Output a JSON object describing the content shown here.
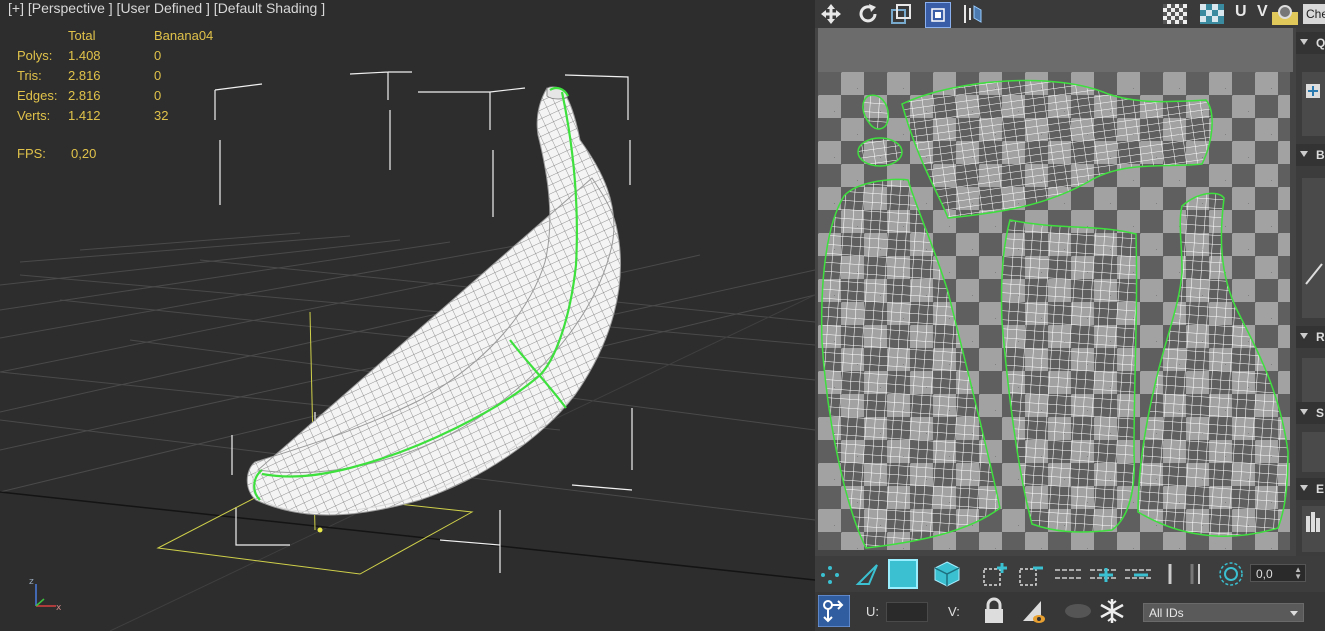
{
  "viewport": {
    "label": "[+] [Perspective ] [User Defined ] [Default Shading ]",
    "stats": {
      "header": {
        "total": "Total",
        "object": "Banana04"
      },
      "rows": [
        {
          "name": "Polys:",
          "total": "1.408",
          "object": "0"
        },
        {
          "name": "Tris:",
          "total": "2.816",
          "object": "0"
        },
        {
          "name": "Edges:",
          "total": "2.816",
          "object": "0"
        },
        {
          "name": "Verts:",
          "total": "1.412",
          "object": "32"
        }
      ],
      "fps_label": "FPS:",
      "fps_value": "0,20"
    },
    "gizmo": {
      "z": "z",
      "x": "x"
    }
  },
  "uv_editor": {
    "toolbar": {
      "uv_label": "U V",
      "checker_label": "Che",
      "icons": [
        "move-icon",
        "rotate-icon",
        "scale-icon",
        "freeform-icon",
        "mirror-icon",
        "checker-pattern-icon",
        "checker-toggle-icon",
        "settings-icon"
      ]
    },
    "right_panel": {
      "sections": [
        "Q",
        "B",
        "R",
        "S",
        "E"
      ]
    },
    "bottom": {
      "angle_value": "0,0",
      "u_label": "U:",
      "v_label": "V:",
      "u_value": "",
      "v_value": "",
      "id_filter": "All IDs"
    },
    "colors": {
      "seam": "#3ee03e",
      "selected": "#3bb7c6"
    }
  }
}
